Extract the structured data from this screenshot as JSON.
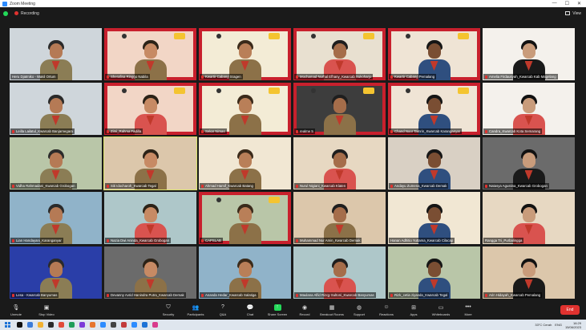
{
  "window": {
    "title": "Zoom Meeting",
    "minimize": "—",
    "maximize": "☐",
    "close": "✕"
  },
  "topstrip": {
    "recording_label": "Recording",
    "view_label": "View"
  },
  "participants": [
    {
      "name": "Heru Djatmiko - Wakil Ortum",
      "mic": false
    },
    {
      "name": "Sherafina Ringgo Nabila",
      "mic": true
    },
    {
      "name": "Kwartir Cabang Sragen",
      "mic": true
    },
    {
      "name": "Mochamad Nurhal Efhany_Kwarcab Sukoharjo",
      "mic": true
    },
    {
      "name": "Kwartir Cabang Pemalang",
      "mic": true
    },
    {
      "name": "Amelia Firdausyah_Kwarcab Kab Magelang",
      "mic": true
    },
    {
      "name": "Leilla Lailatul_Kwarcab Banjarnegara",
      "mic": true
    },
    {
      "name": "Zimi_Rahma Fadilla",
      "mic": true
    },
    {
      "name": "Sekar Nimas",
      "mic": true
    },
    {
      "name": "realme 5",
      "mic": true
    },
    {
      "name": "Chand Noor Tamrin_Kwarcab Karanganyar",
      "mic": true
    },
    {
      "name": "Candra_Kwarcab Kota Semarang",
      "mic": true
    },
    {
      "name": "Vidha Rahmadani_Kwarcab Grobogan",
      "mic": true
    },
    {
      "name": "Siti Idocharoh_Kwarcab Tegal",
      "mic": true
    },
    {
      "name": "Ahmad Hamif_Kwarcab Batang",
      "mic": true
    },
    {
      "name": "Nurul Nigiani_Kwarcab Klaten",
      "mic": true
    },
    {
      "name": "Andayu Zumena_Kwarcab Demak",
      "mic": true
    },
    {
      "name": "Natasya Agustina_Kwarcab Grobogan",
      "mic": true
    },
    {
      "name": "Lian Handayani_Karanganyar",
      "mic": true
    },
    {
      "name": "Nazia Dwi Aninda_Kwarcab Grobogan",
      "mic": true
    },
    {
      "name": "CAPSLAB",
      "mic": true
    },
    {
      "name": "Muhammad Nur Amin_Kwarcab Demak",
      "mic": true
    },
    {
      "name": "Hanan Adhitio Yuttama_Kwarcab Cilacap",
      "mic": false
    },
    {
      "name": "Rangga Tri_Purbalingga",
      "mic": false
    },
    {
      "name": "Lesa - Kwarcab Banyumas",
      "mic": true
    },
    {
      "name": "Devanny Avrid Hanindra Putra_Kwarcab Demak",
      "mic": true
    },
    {
      "name": "Ananda Hedar_Kwarcab Salatiga",
      "mic": true
    },
    {
      "name": "Maulana Alfid Rizqy Sultoni_Kwarcab Banyumas",
      "mic": true
    },
    {
      "name": "Rizk_cetia ziyanda_Kwarcab Tegal",
      "mic": true
    },
    {
      "name": "Arin Hidayah_Kwarcab Pemalang",
      "mic": true
    }
  ],
  "toolbar": {
    "unmute": "Unmute",
    "stop_video": "Stop Video",
    "security": "Security",
    "participants": "Participants",
    "participants_count": "85",
    "qa": "Q&A",
    "chat": "Chat",
    "share_screen": "Share Screen",
    "record": "Record",
    "breakout_rooms": "Breakout Rooms",
    "support": "Support",
    "reactions": "Reactions",
    "apps": "Apps",
    "whiteboards": "Whiteboards",
    "more": "More",
    "end": "End"
  },
  "taskbar": {
    "weather": "33°C Cerah",
    "lang": "ENG",
    "time": "16:29",
    "date": "15/06/2023"
  }
}
